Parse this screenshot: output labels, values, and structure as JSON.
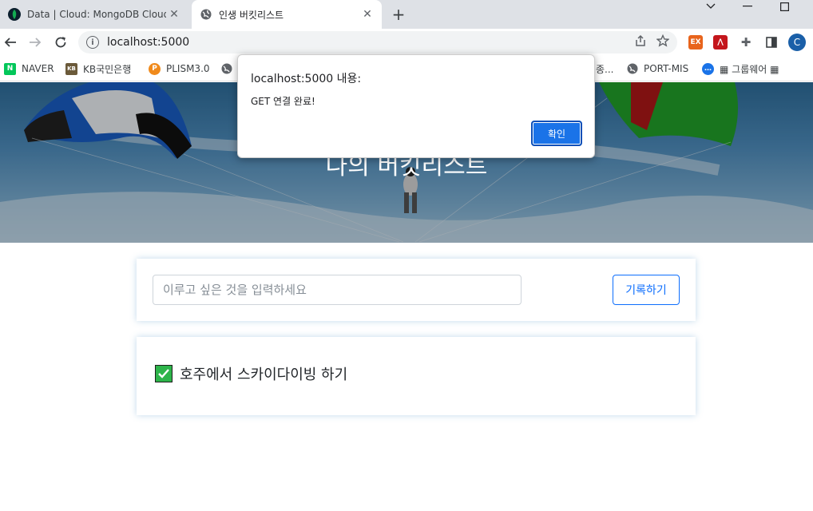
{
  "tabs": [
    {
      "title": "Data | Cloud: MongoDB Cloud",
      "icon": "mongodb-leaf-icon",
      "color": "#13aa52"
    },
    {
      "title": "인생 버킷리스트",
      "icon": "globe-icon"
    }
  ],
  "window": {
    "minimize": "—",
    "maximize": "☐",
    "dropdown": "⌄"
  },
  "address_bar": {
    "url": "localhost:5000"
  },
  "profile_initial": "C",
  "bookmarks": [
    {
      "label": "NAVER",
      "icon_text": "N",
      "color": "#03c75a"
    },
    {
      "label": "KB국민은행",
      "icon_text": "KB",
      "color": "#6b5a3a"
    },
    {
      "label": "PLISM3.0",
      "icon_text": "P",
      "color": "#f08a1c"
    },
    {
      "label": "종...",
      "icon_text": "",
      "color": "#5f6368"
    },
    {
      "label": "PORT-MIS",
      "icon_text": "",
      "color": "#5f6368"
    },
    {
      "label": "▦ 그룹웨어 ▦",
      "icon_text": "",
      "color": "#1a73e8"
    }
  ],
  "hero": {
    "title": "나의 버킷리스트"
  },
  "form": {
    "placeholder": "이루고 싶은 것을 입력하세요",
    "button_label": "기록하기"
  },
  "bucket_list": [
    {
      "text": "호주에서 스카이다이빙 하기",
      "done": true
    }
  ],
  "dialog": {
    "title": "localhost:5000 내용:",
    "message": "GET 연결 완료!",
    "ok_label": "확인"
  }
}
